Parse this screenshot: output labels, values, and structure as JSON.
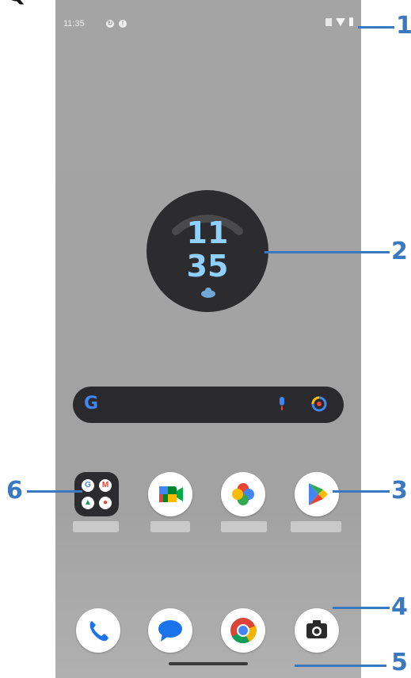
{
  "status_bar": {
    "time": "11:35"
  },
  "clock_widget": {
    "hour": "11",
    "minute": "35"
  },
  "callouts": [
    "1",
    "2",
    "3",
    "4",
    "5",
    "6"
  ],
  "apps_row": [
    "Google folder",
    "Meet",
    "Photos",
    "Play Store"
  ],
  "dock": [
    "Phone",
    "Messages",
    "Chrome",
    "Camera"
  ],
  "colors": {
    "callout": "#3a78c2",
    "clock_digits": "#8fd0ff",
    "widget_bg": "#2c2c2e",
    "wallpaper": "#a4a4a4"
  }
}
